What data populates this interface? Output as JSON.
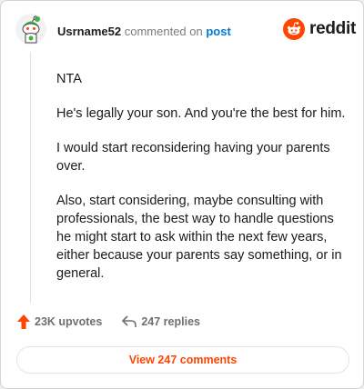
{
  "header": {
    "username": "Usrname52",
    "commented_text": "commented on",
    "post_link": "post",
    "brand": "reddit",
    "brand_color": "#ff4500",
    "link_color": "#0079d3"
  },
  "comment": {
    "paragraphs": [
      "NTA",
      "He's legally your son. And you're the best for him.",
      "I would start reconsidering having your parents over.",
      "Also, start considering, maybe consulting with professionals, the best way to handle questions he might start to ask within the next few years, either because your parents say something, or in general."
    ]
  },
  "footer": {
    "upvotes": "23K upvotes",
    "replies": "247 replies",
    "view_comments": "View 247 comments",
    "upvote_icon": "upvote-arrow-icon",
    "reply_icon": "reply-arrow-icon"
  }
}
